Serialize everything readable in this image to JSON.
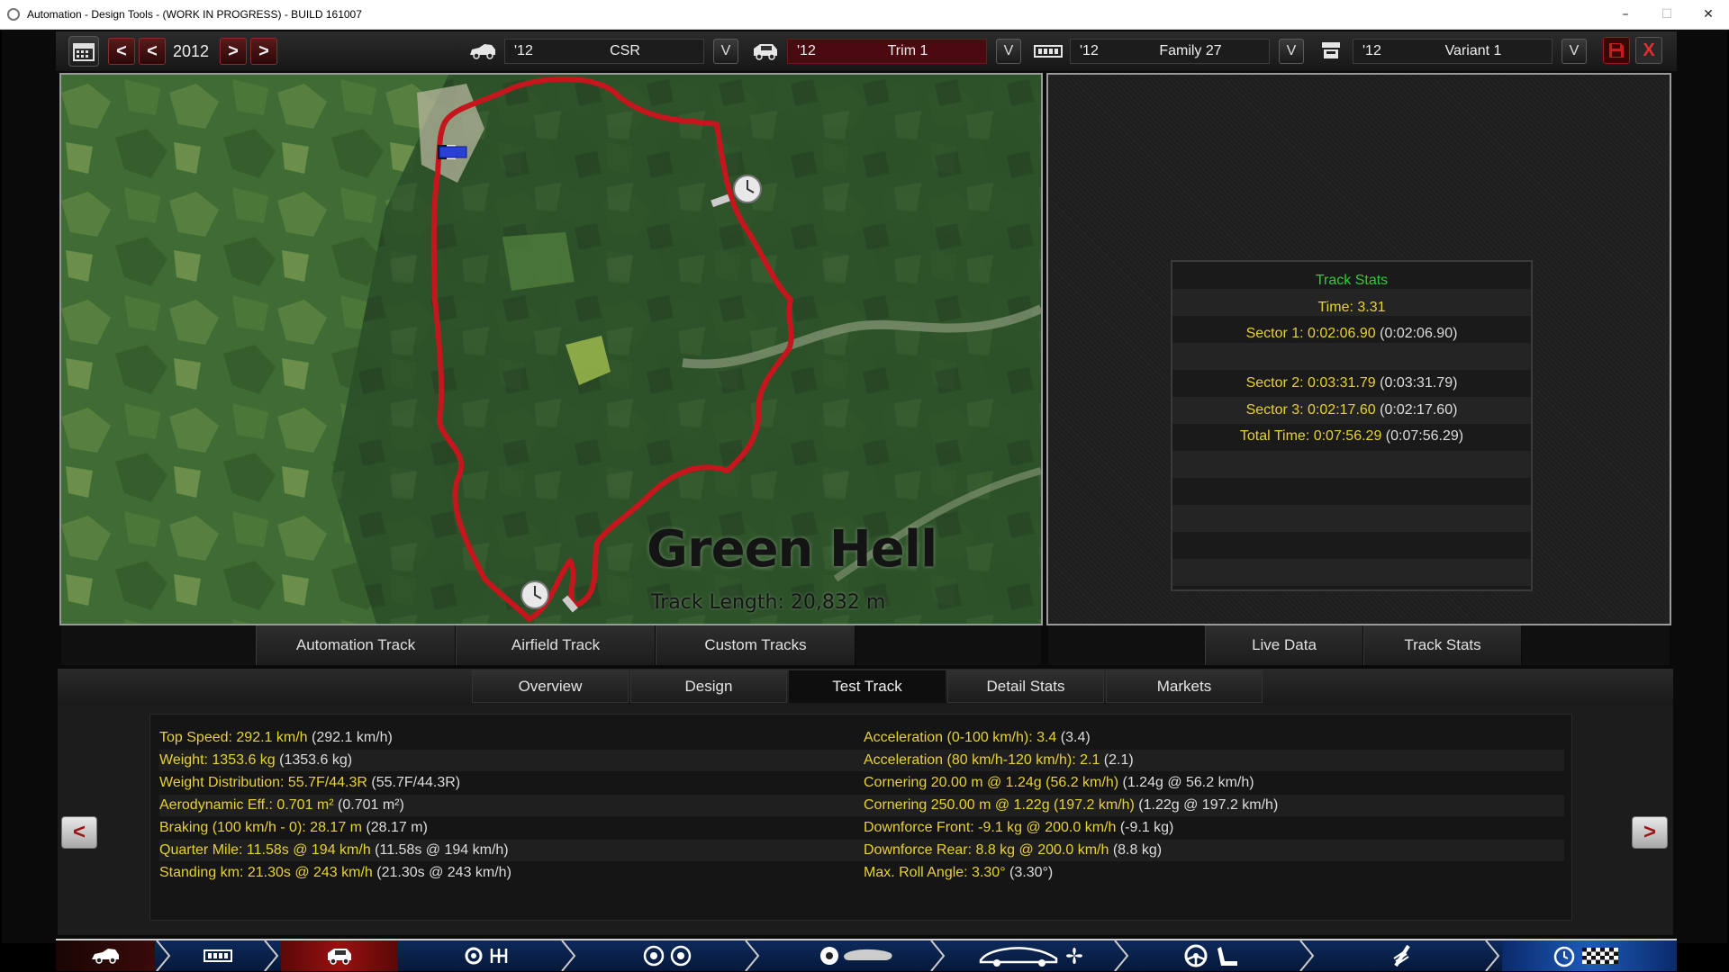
{
  "window": {
    "title": "Automation - Design Tools - (WORK IN PROGRESS) - BUILD 161007",
    "minimize": "–",
    "maximize": "☐",
    "close": "✕"
  },
  "toolbar": {
    "year": "2012",
    "prev_fast": "<",
    "prev": "<",
    "next": ">",
    "next_fast": ">",
    "selectors": [
      {
        "icon": "car-model-icon",
        "year": "'12",
        "name": "CSR"
      },
      {
        "icon": "trim-icon",
        "year": "'12",
        "name": "Trim 1"
      },
      {
        "icon": "engine-family-icon",
        "year": "'12",
        "name": "Family 27"
      },
      {
        "icon": "engine-variant-icon",
        "year": "'12",
        "name": "Variant 1"
      }
    ],
    "dropdown": "V",
    "close_label": "X"
  },
  "map": {
    "track_name": "Green Hell",
    "track_length": "Track Length: 20,832 m"
  },
  "track_tabs": [
    "Automation Track",
    "Airfield Track",
    "Custom Tracks"
  ],
  "stats_tabs": [
    "Live Data",
    "Track Stats"
  ],
  "track_stats": {
    "title": "Track Stats",
    "time": "Time: 3.31",
    "sectors": [
      {
        "label": "Sector 1: 0:02:06.90",
        "paren": "(0:02:06.90)"
      },
      {
        "label": "Sector 2: 0:03:31.79",
        "paren": "(0:03:31.79)"
      },
      {
        "label": "Sector 3: 0:02:17.60",
        "paren": "(0:02:17.60)"
      },
      {
        "label": "Total Time: 0:07:56.29",
        "paren": "(0:07:56.29)"
      }
    ]
  },
  "section_tabs": [
    {
      "label": "Overview",
      "active": false
    },
    {
      "label": "Design",
      "active": false
    },
    {
      "label": "Test Track",
      "active": true
    },
    {
      "label": "Detail Stats",
      "active": false
    },
    {
      "label": "Markets",
      "active": false
    }
  ],
  "stats_left": [
    {
      "label": "Top Speed: 292.1 km/h",
      "paren": "(292.1 km/h)"
    },
    {
      "label": "Weight: 1353.6 kg",
      "paren": "(1353.6 kg)"
    },
    {
      "label": "Weight Distribution: 55.7F/44.3R",
      "paren": "(55.7F/44.3R)"
    },
    {
      "label": "Aerodynamic Eff.: 0.701 m²",
      "paren": "(0.701 m²)"
    },
    {
      "label": "Braking (100 km/h - 0): 28.17 m",
      "paren": "(28.17 m)"
    },
    {
      "label": "Quarter Mile: 11.58s @ 194 km/h",
      "paren": "(11.58s @ 194 km/h)"
    },
    {
      "label": "Standing km: 21.30s @ 243 km/h",
      "paren": "(21.30s @ 243 km/h)"
    }
  ],
  "stats_right": [
    {
      "label": "Acceleration (0-100 km/h): 3.4",
      "paren": "(3.4)"
    },
    {
      "label": "Acceleration (80 km/h-120 km/h): 2.1",
      "paren": "(2.1)"
    },
    {
      "label": "Cornering 20.00 m @ 1.24g (56.2 km/h)",
      "paren": "(1.24g @ 56.2 km/h)"
    },
    {
      "label": "Cornering 250.00 m @ 1.22g (197.2 km/h)",
      "paren": "(1.22g @ 197.2 km/h)"
    },
    {
      "label": "Downforce Front: -9.1 kg @ 200.0 km/h",
      "paren": "(-9.1 kg)"
    },
    {
      "label": "Downforce Rear: 8.8 kg @ 200.0 km/h",
      "paren": "(8.8 kg)"
    },
    {
      "label": "Max. Roll Angle: 3.30°",
      "paren": "(3.30°)"
    }
  ],
  "nav_arrows": {
    "left": "<",
    "right": ">"
  },
  "workflow_steps": [
    {
      "name": "workflow-model-step",
      "icon": "car-body-icon",
      "active": true
    },
    {
      "name": "workflow-family-step",
      "icon": "engine-block-icon",
      "active": false
    },
    {
      "name": "workflow-trim-step",
      "icon": "trim-icon",
      "active": true
    },
    {
      "name": "workflow-drivetrain-step",
      "icon": "gearbox-icon",
      "active": false
    },
    {
      "name": "workflow-suspension-step",
      "icon": "wheels-icon",
      "active": false
    },
    {
      "name": "workflow-tires-step",
      "icon": "tire-icon",
      "active": false
    },
    {
      "name": "workflow-aero-step",
      "icon": "aero-fan-icon",
      "active": false
    },
    {
      "name": "workflow-interior-step",
      "icon": "steering-seat-icon",
      "active": false
    },
    {
      "name": "workflow-safety-step",
      "icon": "shock-icon",
      "active": false
    },
    {
      "name": "workflow-test-step",
      "icon": "stopwatch-flag-icon",
      "active": true
    }
  ],
  "colors": {
    "stat_label": "#e8d230",
    "stat_paren": "#dddddd",
    "stats_title": "#33cc33",
    "track_line": "#c4161c",
    "accent_red": "#9c1414"
  }
}
